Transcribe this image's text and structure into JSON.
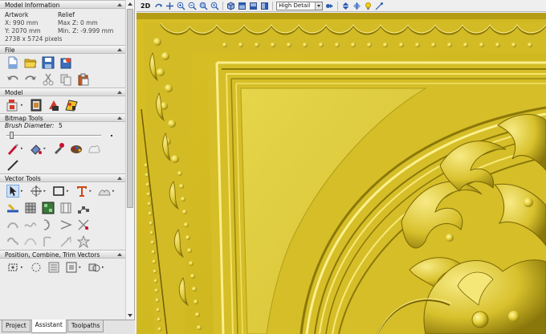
{
  "model_information": {
    "header": "Model Information",
    "artwork_label": "Artwork",
    "relief_label": "Relief",
    "x_size": "X: 990 mm",
    "max_z": "Max Z: 0 mm",
    "y_size": "Y: 2070 mm",
    "min_z": "Min. Z: -9.999 mm",
    "pixels": "2738 x 5724 pixels"
  },
  "sections": {
    "file": "File",
    "model": "Model",
    "bitmap_tools": "Bitmap Tools",
    "vector_tools": "Vector Tools",
    "position_combine": "Position, Combine, Trim Vectors"
  },
  "bitmap": {
    "brush_label": "Brush Diameter:",
    "brush_value": "5",
    "brush_level_fraction": 0.03
  },
  "toolbar": {
    "view_2d": "2D",
    "detail_level": "High Detail"
  },
  "tabs": [
    "Project",
    "Assistant",
    "Toolpaths"
  ],
  "active_tab": "Assistant",
  "colors": {
    "relief_gold": "#d9c22f",
    "relief_highlight": "#f4e777",
    "relief_shadow": "#8c7a10"
  }
}
